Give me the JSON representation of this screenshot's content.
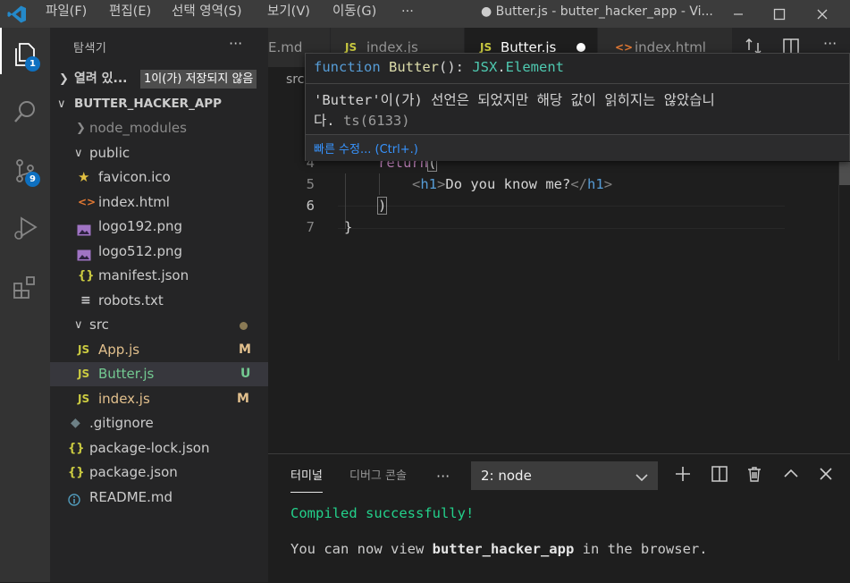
{
  "titlebar": {
    "menus": [
      "파일(F)",
      "편집(E)",
      "선택 영역(S)",
      "보기(V)",
      "이동(G)",
      "···"
    ],
    "window_title": "● Butter.js - butter_hacker_app - Vi..."
  },
  "activity": {
    "explorer_badge": "1",
    "scm_badge": "9"
  },
  "sidebar": {
    "title": "탐색기",
    "more": "···",
    "open_editors_label": "열려 있...",
    "unsaved_label": "1이(가) 저장되지 않음",
    "project_name": "BUTTER_HACKER_APP",
    "tree": {
      "node_modules": "node_modules",
      "public": "public",
      "favicon": "favicon.ico",
      "index_html": "index.html",
      "logo192": "logo192.png",
      "logo512": "logo512.png",
      "manifest": "manifest.json",
      "robots": "robots.txt",
      "src": "src",
      "app_js": "App.js",
      "app_js_status": "M",
      "butter_js": "Butter.js",
      "butter_js_status": "U",
      "index_js": "index.js",
      "index_js_status": "M",
      "gitignore": ".gitignore",
      "package_lock": "package-lock.json",
      "package_json": "package.json",
      "readme": "README.md"
    }
  },
  "tabs": {
    "readme": "E.md",
    "index_js": "index.js",
    "butter_js": "Butter.js",
    "index_html": "index.html",
    "js_glyph": "JS",
    "html_glyph": "<>"
  },
  "breadcrumb": "src",
  "hover": {
    "sig_keyword": "function",
    "sig_name": "Butter",
    "sig_parens": "(): ",
    "sig_type_ns": "JSX",
    "sig_dot": ".",
    "sig_type": "Element",
    "message_line1": "'Butter'이(가) 선언은 되었지만 해당 값이 읽히지는 않았습니",
    "message_line2_a": "다.",
    "message_line2_b": "ts(6133)",
    "quick_fix": "빠른 수정... (Ctrl+.)"
  },
  "editor": {
    "line_numbers": [
      "4",
      "5",
      "6",
      "7"
    ],
    "line4_kw": "return",
    "line4_paren": "(",
    "line5_open_lt": "<",
    "line5_tag": "h1",
    "line5_open_gt": ">",
    "line5_text": "Do you know me?",
    "line5_close_lt": "</",
    "line5_close_tag": "h1",
    "line5_close_gt": ">",
    "line6": ")",
    "line7": "}"
  },
  "panel": {
    "tab_terminal": "터미널",
    "tab_debug": "디버그 콘솔",
    "more": "···",
    "terminal_select": "2: node",
    "term_line1": "Compiled successfully!",
    "term_line2_a": "You can now view ",
    "term_line2_b": "butter_hacker_app",
    "term_line2_c": " in the browser."
  }
}
